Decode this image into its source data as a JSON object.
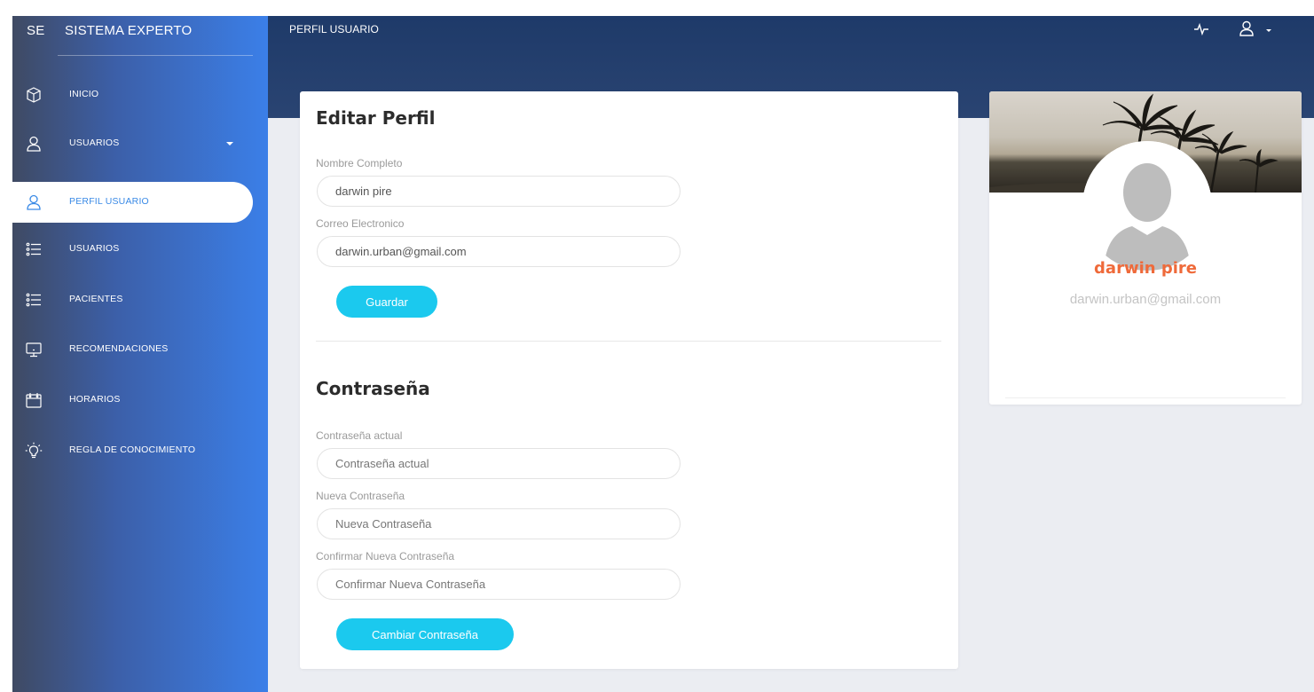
{
  "sidebar": {
    "brand_short": "SE",
    "brand_full": "SISTEMA EXPERTO",
    "items": [
      {
        "label": "INICIO",
        "icon": "cube-icon"
      },
      {
        "label": "USUARIOS",
        "icon": "user-icon",
        "has_dropdown": true
      },
      {
        "label": "PERFIL USUARIO",
        "icon": "user-icon",
        "active": true
      },
      {
        "label": "USUARIOS",
        "icon": "list-icon"
      },
      {
        "label": "PACIENTES",
        "icon": "list-icon"
      },
      {
        "label": "RECOMENDACIONES",
        "icon": "monitor-icon"
      },
      {
        "label": "HORARIOS",
        "icon": "calendar-icon"
      },
      {
        "label": "REGLA DE CONOCIMIENTO",
        "icon": "bulb-icon"
      }
    ]
  },
  "header": {
    "title": "PERFIL USUARIO",
    "icons": [
      "pulse-icon",
      "user-icon",
      "caret-down-icon"
    ]
  },
  "edit_profile": {
    "title": "Editar Perfil",
    "name_label": "Nombre Completo",
    "name_value": "darwin pire",
    "email_label": "Correo Electronico",
    "email_value": "darwin.urban@gmail.com",
    "save_label": "Guardar"
  },
  "password": {
    "title": "Contraseña",
    "current_label": "Contraseña actual",
    "current_placeholder": "Contraseña actual",
    "new_label": "Nueva Contraseña",
    "new_placeholder": "Nueva Contraseña",
    "confirm_label": "Confirmar Nueva Contraseña",
    "confirm_placeholder": "Confirmar Nueva Contraseña",
    "change_label": "Cambiar Contraseña"
  },
  "profile_card": {
    "name": "darwin pire",
    "email": "darwin.urban@gmail.com"
  },
  "colors": {
    "accent_button": "#1bc9ee",
    "name_highlight": "#ef6a3a",
    "active_nav_text": "#3a8ae6",
    "header_bg": "#1e3a69"
  }
}
